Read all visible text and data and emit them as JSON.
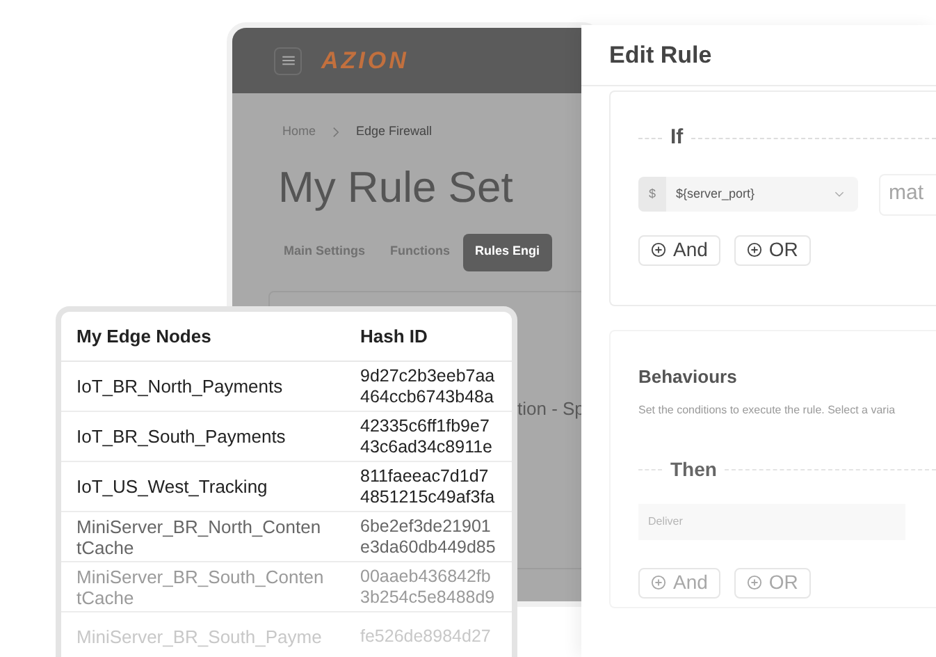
{
  "console": {
    "logo": "AZION",
    "breadcrumb": [
      {
        "label": "Home"
      },
      {
        "label": "Edge Firewall"
      }
    ],
    "title": "My Rule Set",
    "tabs": [
      {
        "label": "Main Settings",
        "selected": false
      },
      {
        "label": "Functions",
        "selected": false
      },
      {
        "label": "Rules Engi",
        "selected": true
      }
    ],
    "partial_text": "tion - Sp"
  },
  "edit_rule": {
    "title": "Edit Rule",
    "criteria": {
      "heading": "If",
      "select": {
        "prefix": "$",
        "value": "${server_port}"
      },
      "partial_field": "mat",
      "buttons": [
        {
          "label": "And"
        },
        {
          "label": "OR"
        }
      ]
    },
    "behaviours": {
      "title": "Behaviours",
      "description": "Set the conditions to execute the rule. Select a varia",
      "heading": "Then",
      "field": {
        "value": "Deliver"
      },
      "buttons": [
        {
          "label": "And"
        },
        {
          "label": "OR"
        }
      ]
    }
  },
  "nodes_table": {
    "columns": [
      "My Edge Nodes",
      "Hash ID"
    ],
    "rows": [
      {
        "name": "IoT_BR_North_Payments",
        "hash": [
          "9d27c2b3eeb7aa",
          "464ccb6743b48a"
        ]
      },
      {
        "name": "IoT_BR_South_Payments",
        "hash": [
          "42335c6ff1fb9e7",
          "43c6ad34c8911e"
        ]
      },
      {
        "name": "IoT_US_West_Tracking",
        "hash": [
          "811faeeac7d1d7",
          "4851215c49af3fa"
        ]
      },
      {
        "name": "MiniServer_BR_North_ContentCache",
        "hash": [
          "6be2ef3de21901",
          "e3da60db449d85"
        ]
      },
      {
        "name": "MiniServer_BR_South_ContentCache",
        "hash": [
          "00aaeb436842fb",
          "3b254c5e8488d9"
        ]
      },
      {
        "name": "MiniServer_BR_South_Payme",
        "hash": [
          "fe526de8984d27"
        ]
      }
    ]
  }
}
